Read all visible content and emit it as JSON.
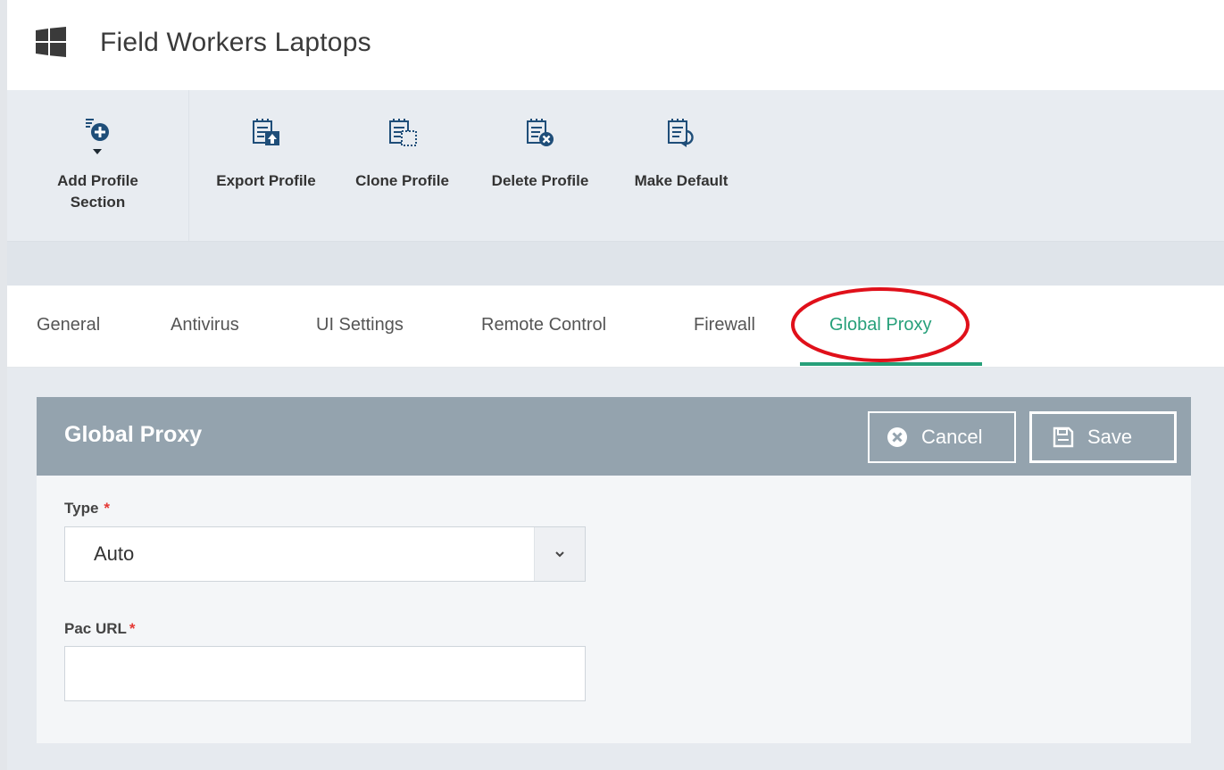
{
  "header": {
    "title": "Field Workers Laptops",
    "os_icon": "windows-logo-icon"
  },
  "toolbar": {
    "buttons": [
      {
        "label_line1": "Add Profile",
        "label_line2": "Section",
        "icon": "add-section-icon"
      },
      {
        "label": "Export Profile",
        "icon": "export-icon"
      },
      {
        "label": "Clone Profile",
        "icon": "clone-icon"
      },
      {
        "label": "Delete Profile",
        "icon": "delete-icon"
      },
      {
        "label": "Make Default",
        "icon": "make-default-icon"
      }
    ]
  },
  "tabs": [
    {
      "label": "General",
      "active": false
    },
    {
      "label": "Antivirus",
      "active": false
    },
    {
      "label": "UI Settings",
      "active": false
    },
    {
      "label": "Remote Control",
      "active": false
    },
    {
      "label": "Firewall",
      "active": false
    },
    {
      "label": "Global Proxy",
      "active": true
    }
  ],
  "panel": {
    "title": "Global Proxy",
    "cancel_label": "Cancel",
    "save_label": "Save"
  },
  "form": {
    "type_label": "Type",
    "type_required": "*",
    "type_value": "Auto",
    "pac_url_label": "Pac URL",
    "pac_url_required": "*",
    "pac_url_value": ""
  },
  "colors": {
    "accent": "#27a07a",
    "panel_header": "#94a3ae",
    "toolbar_bg": "#e8ecf1",
    "required": "#e53935",
    "icon_blue": "#1f4e79",
    "highlight": "#e0101a"
  }
}
